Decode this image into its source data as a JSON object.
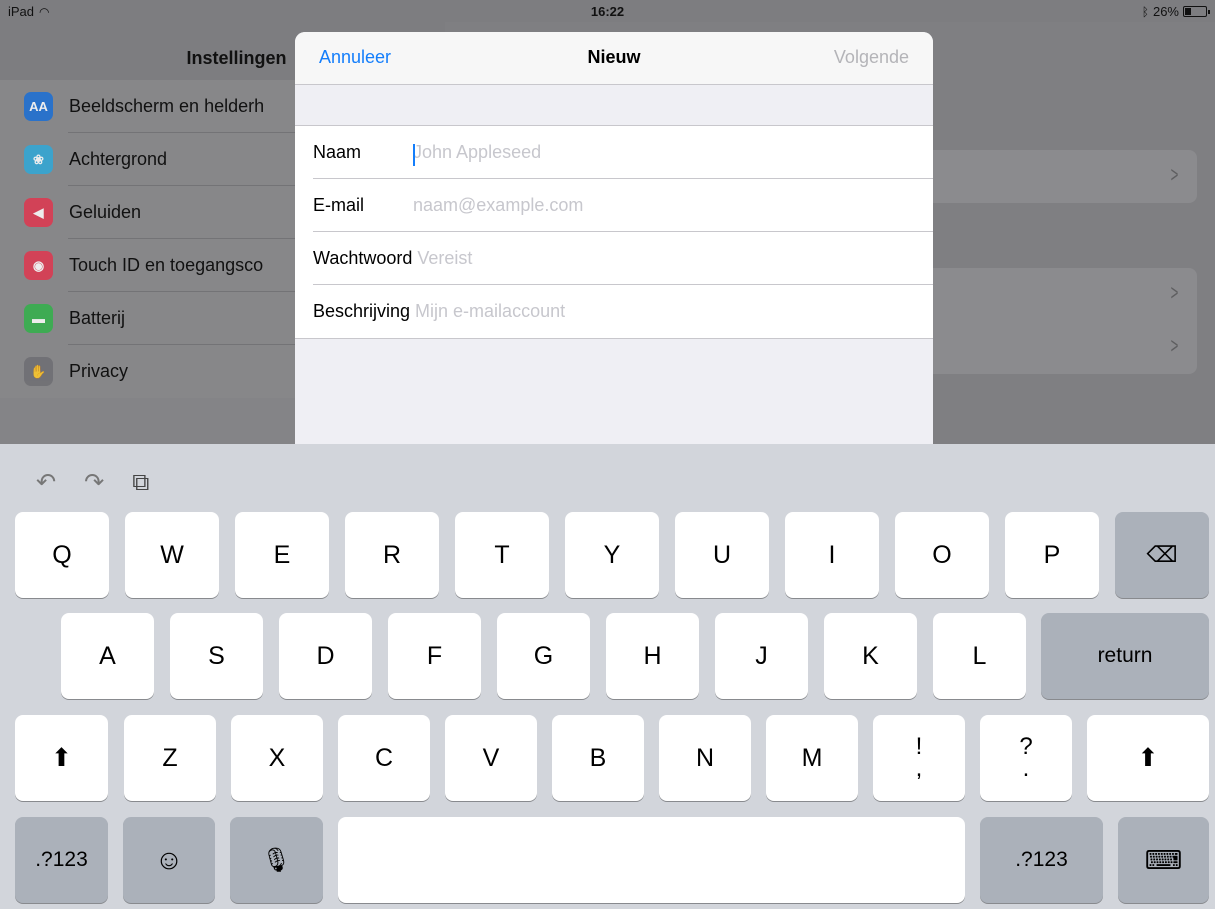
{
  "status_bar": {
    "device": "iPad",
    "time": "16:22",
    "battery": "26%"
  },
  "settings": {
    "title": "Instellingen",
    "items": [
      {
        "label": "Beeldscherm en helderh",
        "icon": "display-brightness-icon",
        "color": "#1a6fd6",
        "glyph": "AA"
      },
      {
        "label": "Achtergrond",
        "icon": "wallpaper-icon",
        "color": "#2fa8d8",
        "glyph": "❀"
      },
      {
        "label": "Geluiden",
        "icon": "sounds-icon",
        "color": "#e0364f",
        "glyph": "◀"
      },
      {
        "label": "Touch ID en toegangsco",
        "icon": "touch-id-icon",
        "color": "#e0364f",
        "glyph": "◉"
      },
      {
        "label": "Batterij",
        "icon": "battery-icon",
        "color": "#32b24a",
        "glyph": "▬"
      },
      {
        "label": "Privacy",
        "icon": "privacy-hand-icon",
        "color": "#6e6e73",
        "glyph": "✋"
      }
    ]
  },
  "modal": {
    "cancel": "Annuleer",
    "title": "Nieuw",
    "next": "Volgende",
    "fields": [
      {
        "label": "Naam",
        "placeholder": "John Appleseed"
      },
      {
        "label": "E-mail",
        "placeholder": "naam@example.com"
      },
      {
        "label": "Wachtwoord",
        "placeholder": "Vereist"
      },
      {
        "label": "Beschrijving",
        "placeholder": "Mijn e-mailaccount"
      }
    ]
  },
  "keyboard": {
    "row1": [
      "Q",
      "W",
      "E",
      "R",
      "T",
      "Y",
      "U",
      "I",
      "O",
      "P"
    ],
    "row2": [
      "A",
      "S",
      "D",
      "F",
      "G",
      "H",
      "J",
      "K",
      "L"
    ],
    "return": "return",
    "row3": [
      "Z",
      "X",
      "C",
      "V",
      "B",
      "N",
      "M"
    ],
    "exclam": {
      "top": "!",
      "bottom": ","
    },
    "question": {
      "top": "?",
      "bottom": "."
    },
    "numbers_left": ".?123",
    "numbers_right": ".?123"
  }
}
